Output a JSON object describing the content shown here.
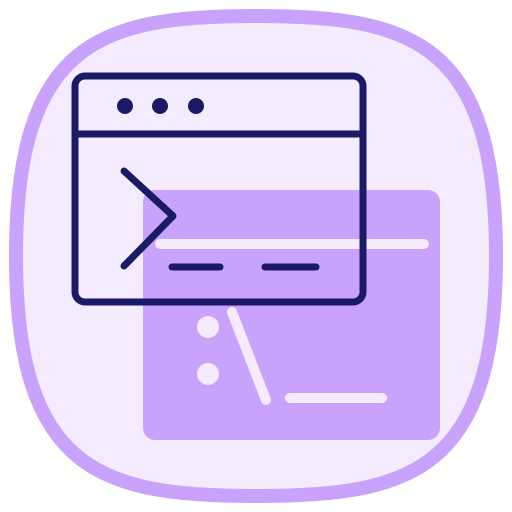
{
  "icon": {
    "name": "terminal-window-icon",
    "colors": {
      "outer_ring": "#c9a3fb",
      "tile_fill": "#f4ecfe",
      "back_window": "#c9a3fb",
      "back_window_lines": "#f4ecfe",
      "front_window_stroke": "#1b1a66"
    }
  }
}
